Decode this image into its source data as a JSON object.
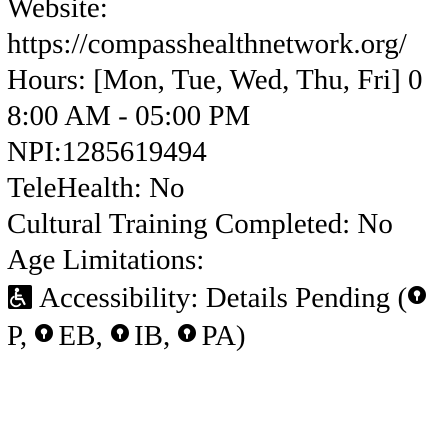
{
  "provider": {
    "website_label": "Website:",
    "website_url": "https://compasshealthnetwork.org/",
    "hours_label": "Hours:",
    "hours_value": "[Mon, Tue, Wed, Thu, Fri] 08:00 AM - 05:00 PM",
    "npi_label": "NPI:",
    "npi_value": "1285619494",
    "telehealth_label": "TeleHealth:",
    "telehealth_value": "No",
    "cultural_label": "Cultural Training Completed:",
    "cultural_value": "No",
    "age_label": "Age Limitations:",
    "accessibility_label": "Accessibility:",
    "accessibility_value": "Details Pending",
    "accessibility_codes": [
      "P",
      "EB",
      "IB",
      "PA"
    ]
  },
  "icons": {
    "accessibility": "accessibility-icon",
    "code_marker": "pin-icon"
  }
}
